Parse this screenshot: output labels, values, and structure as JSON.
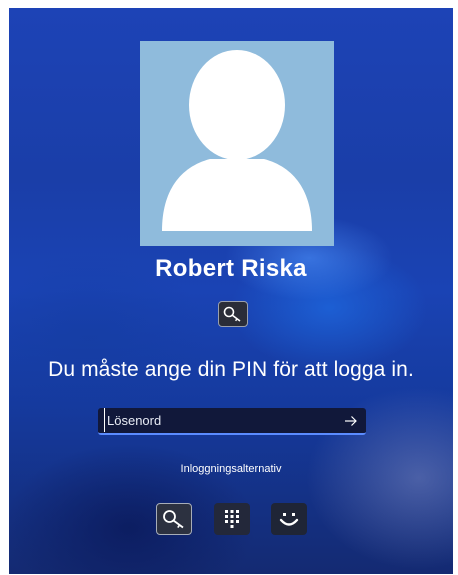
{
  "user": {
    "name": "Robert Riska"
  },
  "prompt": {
    "message": "Du måste ange din PIN för att logga in."
  },
  "password_field": {
    "placeholder": "Lösenord",
    "value": ""
  },
  "signin_options": {
    "label": "Inloggningsalternativ",
    "options": [
      {
        "icon": "key-icon",
        "selected": true
      },
      {
        "icon": "keypad-icon",
        "selected": false
      },
      {
        "icon": "smiley-face-icon",
        "selected": false
      }
    ]
  },
  "colors": {
    "background": "#1a43b4",
    "avatar_bg": "#8fbbdc",
    "field_accent": "#5b8cff"
  }
}
